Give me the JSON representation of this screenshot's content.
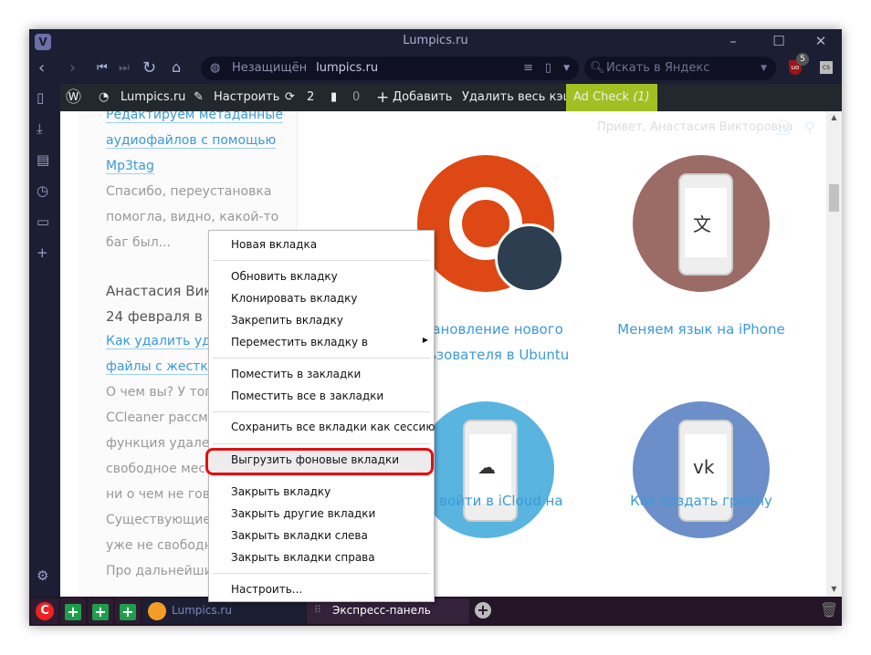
{
  "window": {
    "title": "Lumpics.ru"
  },
  "address_bar": {
    "security": "Незащищён",
    "url": "lumpics.ru",
    "search_placeholder": "Искать в Яндекс",
    "ublock_badge": "5",
    "ext_label": "cs"
  },
  "wp_bar": {
    "site": "Lumpics.ru",
    "customize": "Настроить",
    "updates": "2",
    "comments": "0",
    "add": "Добавить",
    "clear_cache": "Удалить весь кэш",
    "ad_check": "Ad Check",
    "ad_check_count": "(1)"
  },
  "page": {
    "greeting": "Привет, Анастасия Викторовна",
    "sidebar_lines": [
      {
        "t": "Редактируем метаданные",
        "k": "lnk"
      },
      {
        "t": "аудиофайлов с помощью",
        "k": "lnk"
      },
      {
        "t": "Mp3tag",
        "k": "lnk"
      },
      {
        "t": "Спасибо, переустановка",
        "k": "gr"
      },
      {
        "t": "помогла, видно, какой-то",
        "k": "gr"
      },
      {
        "t": "баг был...",
        "k": "gr"
      },
      {
        "t": "Анастасия Викторовна",
        "k": "dk"
      },
      {
        "t": "24 февраля в 1",
        "k": "dk"
      },
      {
        "t": "Как удалить удаленные",
        "k": "lnk"
      },
      {
        "t": "файлы с жесткого",
        "k": "lnk"
      },
      {
        "t": "О чем вы? У того",
        "k": "gr"
      },
      {
        "t": "CCleaner рассмотрена",
        "k": "gr"
      },
      {
        "t": "функция удаления",
        "k": "gr"
      },
      {
        "t": "свободное место",
        "k": "gr"
      },
      {
        "t": "ни о чем не говорит",
        "k": "gr"
      },
      {
        "t": "Существующие с",
        "k": "gr"
      },
      {
        "t": "уже не свободно",
        "k": "gr"
      },
      {
        "t": "Про дальнейшие",
        "k": "gr"
      }
    ],
    "cards": [
      {
        "title1": "Установление нового",
        "title2": "пользователя в Ubuntu",
        "color": "#dd4814"
      },
      {
        "title1": "Меняем язык на iPhone",
        "title2": "",
        "color": "#9b6b66"
      },
      {
        "title1": "Как войти в iCloud на",
        "title2": "",
        "color": "#5ab4e0"
      },
      {
        "title1": "Как создать группу",
        "title2": "",
        "color": "#6c8fc9"
      }
    ]
  },
  "tabs": {
    "lumpics": "Lumpics.ru",
    "express": "Экспресс-панель"
  },
  "context_menu": {
    "items": [
      "Новая вкладка",
      "Обновить вкладку",
      "Клонировать вкладку",
      "Закрепить вкладку",
      "Переместить вкладку в",
      "Поместить в закладки",
      "Поместить все в закладки",
      "Сохранить все вкладки как сессию",
      "Выгрузить фоновые вкладки",
      "Закрыть вкладку",
      "Закрыть другие вкладки",
      "Закрыть вкладки слева",
      "Закрыть вкладки справа",
      "Настроить..."
    ],
    "highlighted": "Выгрузить фоновые вкладки"
  }
}
